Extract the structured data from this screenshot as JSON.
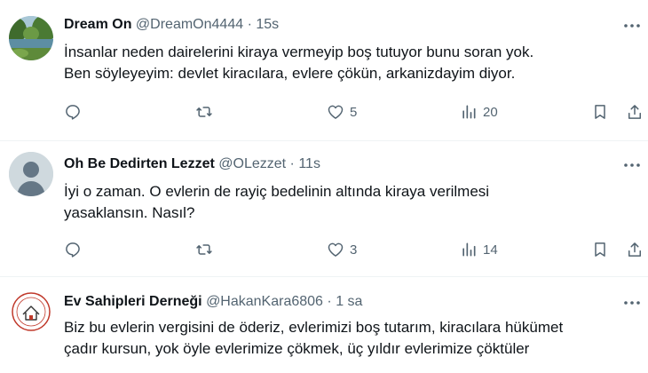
{
  "colors": {
    "text": "#0f1419",
    "muted": "#536471",
    "divider": "#eff3f4"
  },
  "posts": [
    {
      "name": "Dream On",
      "handle": "@DreamOn4444",
      "separator": "·",
      "time": "15s",
      "lines": [
        "İnsanlar neden dairelerini kiraya vermeyip boş tutuyor bunu soran yok.",
        "Ben söyleyeyim: devlet kiracılara, evlere çökün, arkanizdayim diyor."
      ],
      "likes": "5",
      "views": "20",
      "avatar_icon": "landscape-photo"
    },
    {
      "name": "Oh Be Dedirten Lezzet",
      "handle": "@OLezzet",
      "separator": "·",
      "time": "11s",
      "lines": [
        "İyi o zaman. O evlerin de rayiç bedelinin altında kiraya verilmesi",
        "yasaklansın. Nasıl?"
      ],
      "likes": "3",
      "views": "14",
      "avatar_icon": "default-user"
    },
    {
      "name": "Ev Sahipleri Derneği",
      "handle": "@HakanKara6806",
      "separator": "·",
      "time": "1 sa",
      "lines": [
        "Biz bu evlerin vergisini de öderiz, evlerimizi boş tutarım, kiracılara hükümet",
        "çadır kursun, yok öyle evlerimize çökmek, üç yıldır evlerimize çöktüler"
      ],
      "avatar_icon": "association-seal"
    }
  ]
}
